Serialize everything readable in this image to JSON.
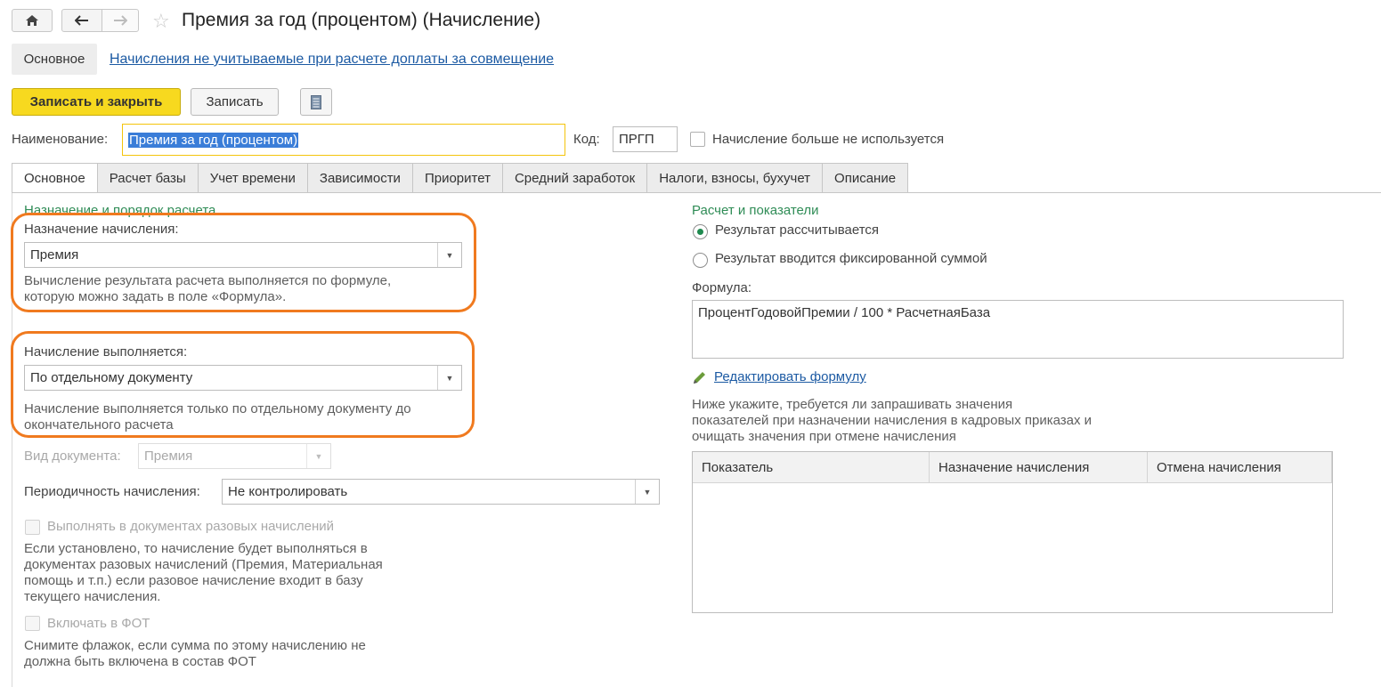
{
  "window": {
    "title": "Премия за год (процентом) (Начисление)"
  },
  "top_nav": {
    "main_tab": "Основное",
    "link": "Начисления не учитываемые при расчете доплаты за совмещение"
  },
  "toolbar": {
    "save_close": "Записать и закрыть",
    "save": "Записать"
  },
  "header_fields": {
    "name_label": "Наименование:",
    "name_value": "Премия за год (процентом)",
    "code_label": "Код:",
    "code_value": "ПРГП",
    "not_used_label": "Начисление больше не используется"
  },
  "tabs": [
    {
      "label": "Основное"
    },
    {
      "label": "Расчет базы"
    },
    {
      "label": "Учет времени"
    },
    {
      "label": "Зависимости"
    },
    {
      "label": "Приоритет"
    },
    {
      "label": "Средний заработок"
    },
    {
      "label": "Налоги, взносы, бухучет"
    },
    {
      "label": "Описание"
    }
  ],
  "left": {
    "section_title": "Назначение и порядок расчета",
    "purpose_label": "Назначение начисления:",
    "purpose_value": "Премия",
    "purpose_hint_1": "Вычисление результата расчета выполняется по формуле,",
    "purpose_hint_2": "которую можно задать в поле «Формула».",
    "execution_label": "Начисление выполняется:",
    "execution_value": "По отдельному документу",
    "execution_hint_1": "Начисление выполняется только по отдельному документу до",
    "execution_hint_2": "окончательного расчета",
    "doc_type_label": "Вид документа:",
    "doc_type_value": "Премия",
    "periodicity_label": "Периодичность начисления:",
    "periodicity_value": "Не контролировать",
    "one_time_label": "Выполнять в документах разовых начислений",
    "one_time_hint_1": "Если установлено, то начисление будет выполняться в",
    "one_time_hint_2": "документах разовых начислений (Премия, Материальная",
    "one_time_hint_3": "помощь и т.п.) если разовое начисление входит в базу",
    "one_time_hint_4": "текущего начисления.",
    "fot_label": "Включать в ФОТ",
    "fot_hint_1": "Снимите флажок, если сумма по этому начислению не",
    "fot_hint_2": "должна быть включена в состав ФОТ"
  },
  "right": {
    "section_title": "Расчет и показатели",
    "radio_calc": "Результат рассчитывается",
    "radio_fixed": "Результат вводится фиксированной суммой",
    "formula_label": "Формула:",
    "formula_value": "ПроцентГодовойПремии / 100 * РасчетнаяБаза",
    "edit_formula_link": "Редактировать формулу",
    "indicators_hint_1": "Ниже укажите, требуется ли запрашивать значения",
    "indicators_hint_2": "показателей при назначении начисления в кадровых приказах и",
    "indicators_hint_3": "очищать значения при отмене начисления",
    "table_headers": [
      "Показатель",
      "Назначение начисления",
      "Отмена начисления"
    ]
  },
  "colors": {
    "accent_yellow": "#f7d91f",
    "section_green": "#2f8c56",
    "highlight_orange": "#f07a1f",
    "link_blue": "#1c5aa3"
  }
}
